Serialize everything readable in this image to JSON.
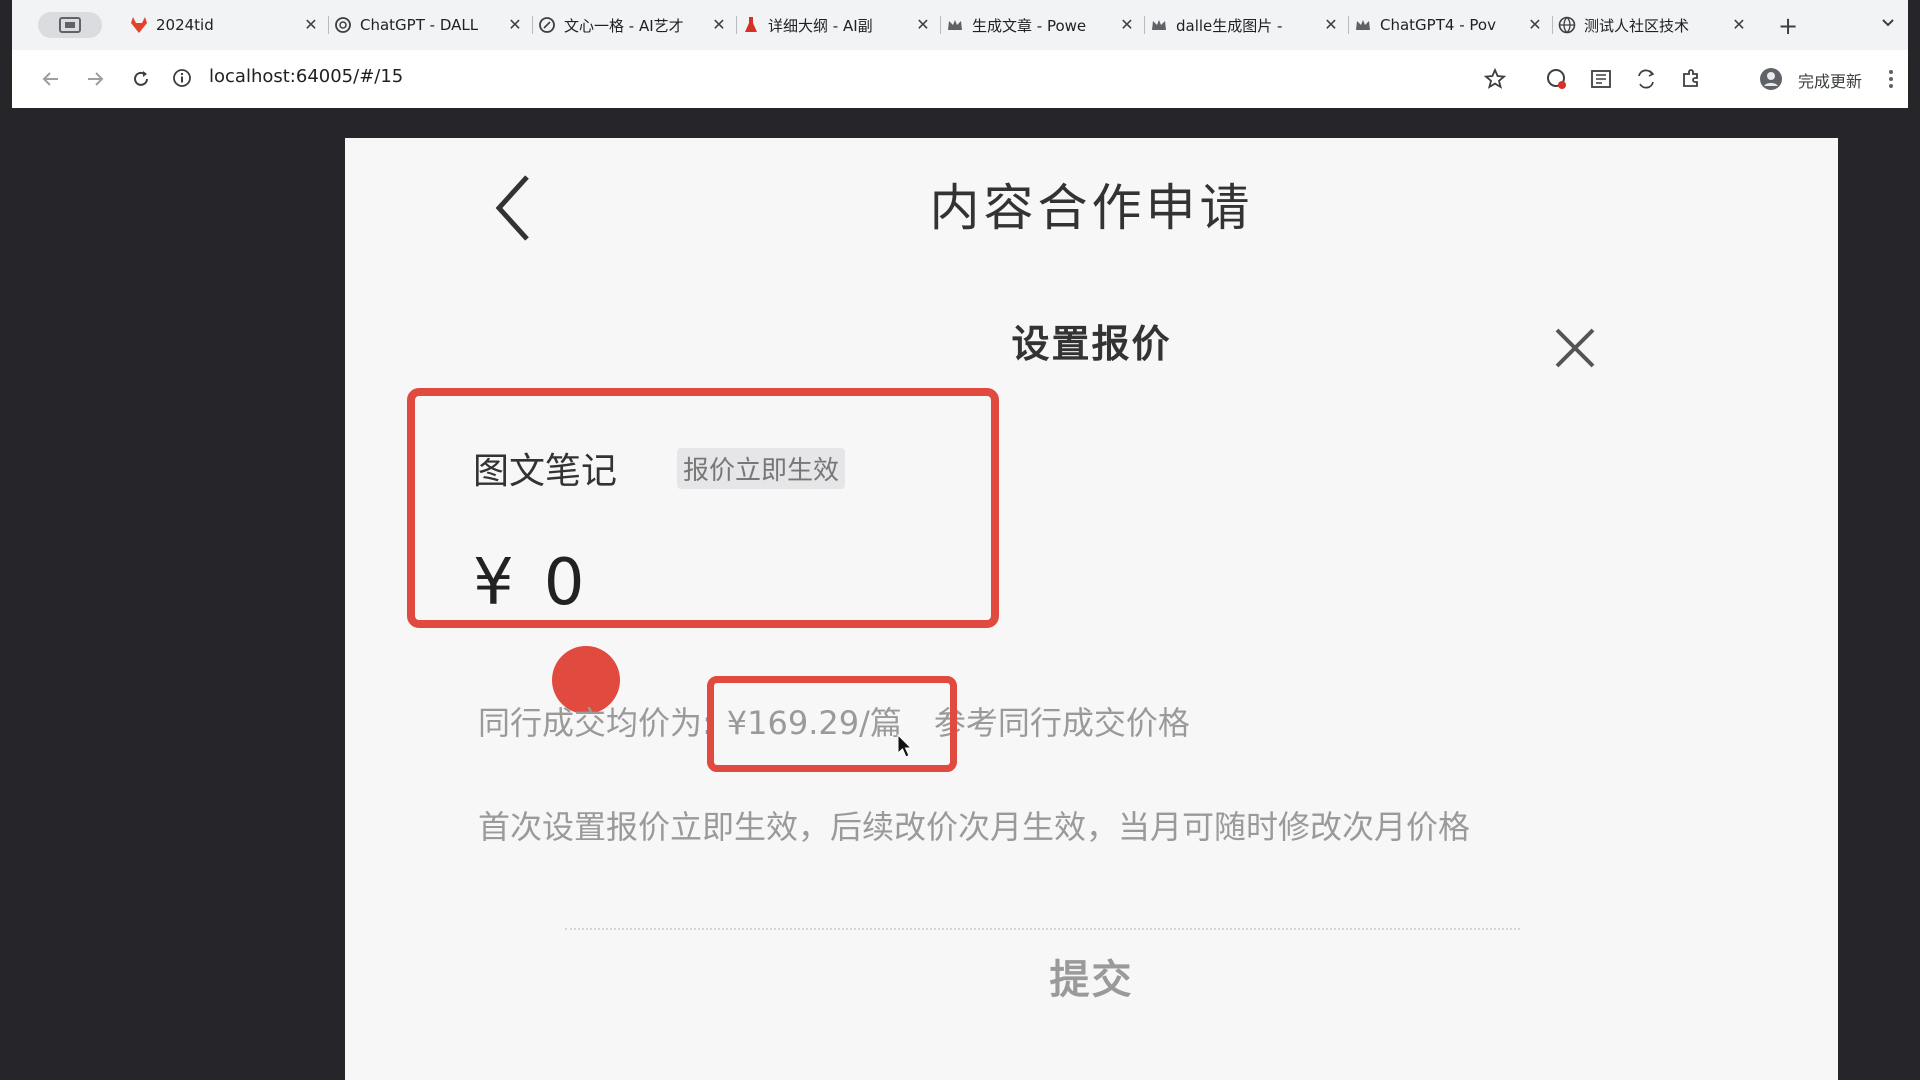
{
  "browser": {
    "tabs": [
      {
        "label": "2024tid",
        "icon": "gitlab-icon",
        "color": "#e24329"
      },
      {
        "label": "ChatGPT - DALL",
        "icon": "openai-icon",
        "color": "#3c4043"
      },
      {
        "label": "文心一格 - AI艺才",
        "icon": "wenxin-icon",
        "color": "#3c4043"
      },
      {
        "label": "详细大纲 - AI副",
        "icon": "flask-icon",
        "color": "#d93025"
      },
      {
        "label": "生成文章 - Powe",
        "icon": "crown-icon",
        "color": "#3c4043"
      },
      {
        "label": "dalle生成图片 - ",
        "icon": "crown-icon",
        "color": "#3c4043"
      },
      {
        "label": "ChatGPT4 - Pov",
        "icon": "crown-icon",
        "color": "#3c4043"
      },
      {
        "label": "测试人社区技术",
        "icon": "globe-icon",
        "color": "#3c4043"
      }
    ],
    "url": "localhost:64005/#/15",
    "update_label": "完成更新"
  },
  "page": {
    "title": "内容合作申请",
    "sheet_title": "设置报价",
    "card": {
      "type_label": "图文笔记",
      "badge": "报价立即生效",
      "currency": "¥",
      "price": "0"
    },
    "reference": {
      "prefix": "同行成交均价为:",
      "average": "¥169.29/篇",
      "suffix": "参考同行成交价格"
    },
    "rule_text": "首次设置报价立即生效，后续改价次月生效，当月可随时修改次月价格",
    "submit_label": "提交"
  },
  "colors": {
    "accent_red": "#e04a3f",
    "muted_text": "#9a9a9a"
  }
}
